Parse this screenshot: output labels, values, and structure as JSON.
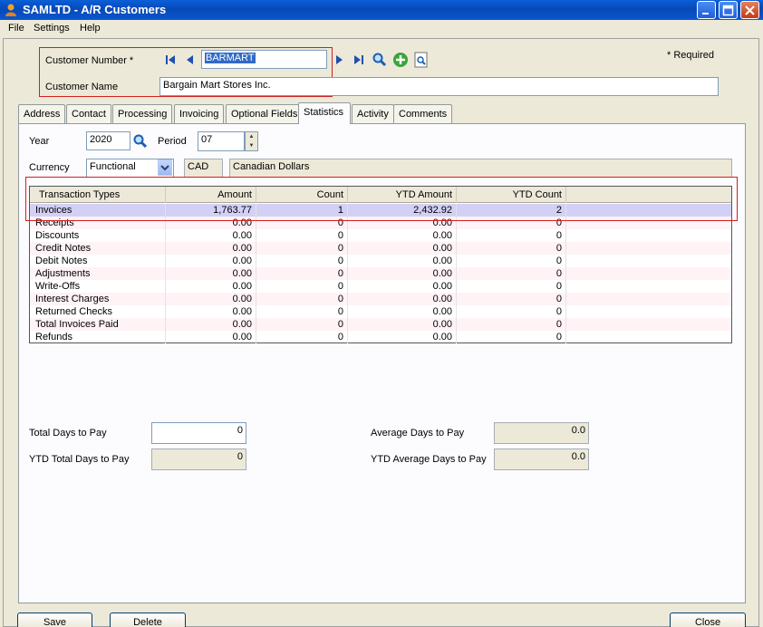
{
  "window": {
    "title": "SAMLTD - A/R Customers"
  },
  "menu": {
    "items": [
      {
        "label": "File"
      },
      {
        "label": "Settings"
      },
      {
        "label": "Help"
      }
    ]
  },
  "header": {
    "customer_number_label": "Customer Number *",
    "customer_number_value": "BARMART",
    "customer_name_label": "Customer Name",
    "customer_name_value": "Bargain Mart Stores Inc.",
    "required_note": "*  Required"
  },
  "tabs": [
    {
      "label": "Address"
    },
    {
      "label": "Contact"
    },
    {
      "label": "Processing"
    },
    {
      "label": "Invoicing"
    },
    {
      "label": "Optional Fields"
    },
    {
      "label": "Statistics",
      "active": true
    },
    {
      "label": "Activity"
    },
    {
      "label": "Comments"
    }
  ],
  "filters": {
    "year_label": "Year",
    "year_value": "2020",
    "period_label": "Period",
    "period_value": "07",
    "currency_label": "Currency",
    "currency_value": "Functional",
    "currency_code": "CAD",
    "currency_name": "Canadian Dollars"
  },
  "grid": {
    "columns": [
      "Transaction Types",
      "Amount",
      "Count",
      "YTD Amount",
      "YTD Count"
    ],
    "rows": [
      [
        "Invoices",
        "1,763.77",
        "1",
        "2,432.92",
        "2"
      ],
      [
        "Receipts",
        "0.00",
        "0",
        "0.00",
        "0"
      ],
      [
        "Discounts",
        "0.00",
        "0",
        "0.00",
        "0"
      ],
      [
        "Credit Notes",
        "0.00",
        "0",
        "0.00",
        "0"
      ],
      [
        "Debit Notes",
        "0.00",
        "0",
        "0.00",
        "0"
      ],
      [
        "Adjustments",
        "0.00",
        "0",
        "0.00",
        "0"
      ],
      [
        "Write-Offs",
        "0.00",
        "0",
        "0.00",
        "0"
      ],
      [
        "Interest Charges",
        "0.00",
        "0",
        "0.00",
        "0"
      ],
      [
        "Returned Checks",
        "0.00",
        "0",
        "0.00",
        "0"
      ],
      [
        "Total Invoices Paid",
        "0.00",
        "0",
        "0.00",
        "0"
      ],
      [
        "Refunds",
        "0.00",
        "0",
        "0.00",
        "0"
      ]
    ]
  },
  "summary": {
    "total_days_label": "Total Days to Pay",
    "total_days_value": "0",
    "ytd_total_days_label": "YTD Total Days to Pay",
    "ytd_total_days_value": "0",
    "avg_days_label": "Average Days to Pay",
    "avg_days_value": "0.0",
    "ytd_avg_days_label": "YTD Average Days to Pay",
    "ytd_avg_days_value": "0.0"
  },
  "buttons": {
    "save": "Save",
    "delete": "Delete",
    "close": "Close"
  },
  "colors": {
    "titlebar": "#0a56cf",
    "highlight_box": "#d02020",
    "selected_row": "#d3d0f5",
    "alt_row": "#fff3f6"
  }
}
